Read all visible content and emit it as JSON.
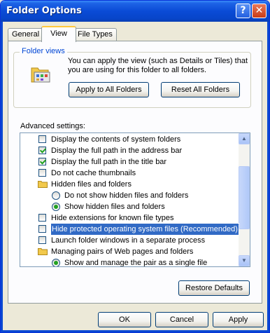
{
  "window": {
    "title": "Folder Options"
  },
  "tabs": [
    "General",
    "View",
    "File Types"
  ],
  "folder_views": {
    "label": "Folder views",
    "description": "You can apply the view (such as Details or Tiles) that you are using for this folder to all folders.",
    "apply_button": "Apply to All Folders",
    "reset_button": "Reset All Folders"
  },
  "advanced": {
    "label": "Advanced settings:",
    "items": [
      {
        "kind": "check",
        "checked": false,
        "label": "Display the contents of system folders"
      },
      {
        "kind": "check",
        "checked": true,
        "label": "Display the full path in the address bar"
      },
      {
        "kind": "check",
        "checked": true,
        "label": "Display the full path in the title bar"
      },
      {
        "kind": "check",
        "checked": false,
        "label": "Do not cache thumbnails"
      },
      {
        "kind": "folder",
        "label": "Hidden files and folders"
      },
      {
        "kind": "radio",
        "checked": false,
        "label": "Do not show hidden files and folders"
      },
      {
        "kind": "radio",
        "checked": true,
        "label": "Show hidden files and folders"
      },
      {
        "kind": "check",
        "checked": false,
        "label": "Hide extensions for known file types"
      },
      {
        "kind": "check",
        "checked": false,
        "label": "Hide protected operating system files (Recommended)",
        "selected": true
      },
      {
        "kind": "check",
        "checked": false,
        "label": "Launch folder windows in a separate process"
      },
      {
        "kind": "folder",
        "label": "Managing pairs of Web pages and folders"
      },
      {
        "kind": "radio",
        "checked": true,
        "label": "Show and manage the pair as a single file"
      }
    ],
    "restore_button": "Restore Defaults"
  },
  "footer": {
    "ok": "OK",
    "cancel": "Cancel",
    "apply": "Apply"
  }
}
